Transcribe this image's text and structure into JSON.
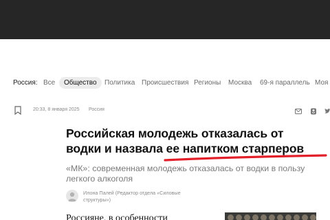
{
  "nav": {
    "region": "Россия:",
    "items": [
      "Все",
      "Общество",
      "Политика",
      "Происшествия",
      "Регионы",
      "Москва",
      "69-я параллель",
      "Моя с"
    ],
    "active_index": 1
  },
  "article": {
    "date": "20:33, 8 января 2025",
    "rubric": "Россия",
    "title_line1": "Российская молодежь отказалась от",
    "title_line2": "водки и назвала ее напитком старперов",
    "subtitle_line1": "«МК»: современная молодежь отказалась от водки в пользу",
    "subtitle_line2": "легкого алкоголя",
    "author_line1": "Илона Палей (Редактор отдела «Силовые",
    "author_line2": "структуры»)",
    "lead": "Россияне, в особенности"
  },
  "colors": {
    "topbar": "#262626",
    "accent_underline": "#e3202a",
    "active_tab_bg": "#ececec"
  },
  "icons": [
    "bookmark-icon",
    "mail-icon",
    "odnoklassniki-icon",
    "twitter-icon"
  ]
}
